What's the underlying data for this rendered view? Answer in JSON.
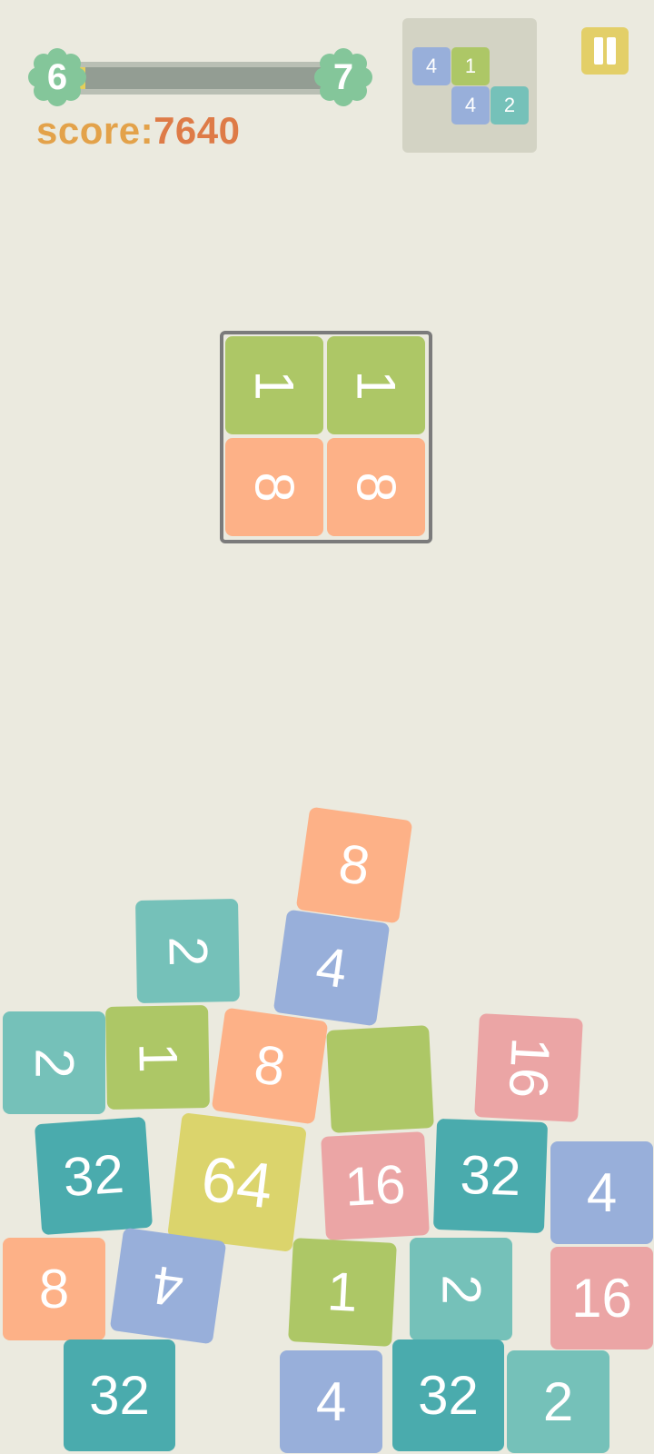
{
  "level": {
    "current": "6",
    "next": "7",
    "progress": 0.03,
    "badge_color": "#84c69a"
  },
  "score": {
    "label": "score:",
    "value": "7640"
  },
  "next_piece": {
    "tiles": [
      {
        "value": "4",
        "color": "blue"
      },
      {
        "value": "1",
        "color": "green"
      },
      {
        "value": "4",
        "color": "blue"
      },
      {
        "value": "2",
        "color": "teal"
      }
    ]
  },
  "pause_icon": "pause-icon",
  "falling_piece": {
    "tiles": [
      {
        "value": "1",
        "color": "green"
      },
      {
        "value": "1",
        "color": "green"
      },
      {
        "value": "8",
        "color": "orange"
      },
      {
        "value": "8",
        "color": "orange"
      }
    ]
  },
  "board": {
    "tiles": [
      {
        "value": "8",
        "color": "orange"
      },
      {
        "value": "2",
        "color": "teal"
      },
      {
        "value": "4",
        "color": "blue"
      },
      {
        "value": "2",
        "color": "teal"
      },
      {
        "value": "1",
        "color": "green"
      },
      {
        "value": "8",
        "color": "orange"
      },
      {
        "value": "",
        "color": "green"
      },
      {
        "value": "16",
        "color": "pink"
      },
      {
        "value": "32",
        "color": "darkteal"
      },
      {
        "value": "64",
        "color": "yellow"
      },
      {
        "value": "16",
        "color": "pink"
      },
      {
        "value": "32",
        "color": "darkteal"
      },
      {
        "value": "4",
        "color": "blue"
      },
      {
        "value": "8",
        "color": "orange"
      },
      {
        "value": "4",
        "color": "blue"
      },
      {
        "value": "1",
        "color": "green"
      },
      {
        "value": "2",
        "color": "teal"
      },
      {
        "value": "16",
        "color": "pink"
      },
      {
        "value": "32",
        "color": "darkteal"
      },
      {
        "value": "4",
        "color": "blue"
      },
      {
        "value": "32",
        "color": "darkteal"
      },
      {
        "value": "2",
        "color": "teal"
      }
    ]
  }
}
